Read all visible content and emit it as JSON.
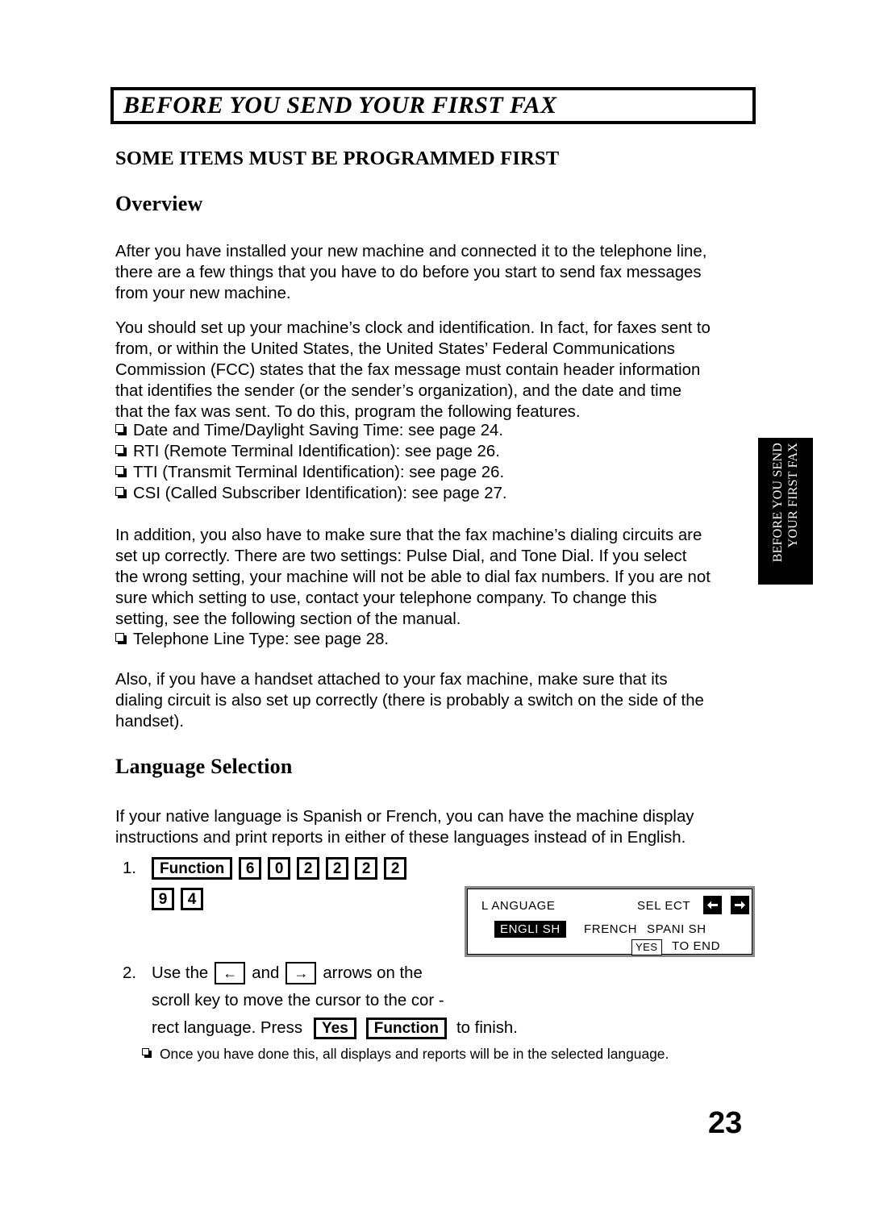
{
  "chapter": {
    "title": "BEFORE YOU SEND YOUR FIRST FAX"
  },
  "side_tab": {
    "line1": "BEFORE YOU SEND",
    "line2": "YOUR FIRST FAX"
  },
  "section": {
    "heading": "SOME ITEMS MUST BE PROGRAMMED FIRST"
  },
  "overview": {
    "heading": "Overview",
    "para1": [
      "After you have installed your new machine and connected it  to the telephone line,",
      "there are a few things that you have to do before you start to send fax messages",
      "from your new machine."
    ],
    "para2": [
      "You should set up your machine’s clock and identification. In fact, for faxes sent to",
      "from, or within the United States, the United States’ Federal Communications",
      "Commission (FCC) states that the fax message must contain header information",
      "that identifies the sender (or the sender’s organization), and the date and time",
      "that the fax was sent. To do this, program the following features."
    ],
    "feature_bullets": [
      "Date and Time/Daylight Saving Time: see page  24.",
      "RTI (Remote Terminal Identification): see page  26.",
      "TTI (Transmit Terminal Identification): see page  26.",
      "CSI (Called Subscriber Identification): see page  27."
    ],
    "para3": [
      "In addition, you also have to make sure that the fax machine’s dialing circuits are",
      "set up correctly. There are two settings: Pulse Dial, and Tone Dial. If you select",
      "the wrong setting, your machine will not be able to dial fax numbers. If you are not",
      "sure which setting to use, contact your telephone company. To change this",
      "setting, see the following section of the manual."
    ],
    "line_type_bullets": [
      "Telephone Line Type: see page  28."
    ],
    "para4": [
      "Also, if you have a handset attached to your fax machine, make sure that its",
      "dialing circuit is also set up correctly (there is probably a switch on the side of the",
      "handset)."
    ]
  },
  "language_selection": {
    "heading": "Language Selection",
    "para1": [
      "If your native language is Spanish or French, you can have the machine display",
      "instructions and print reports in either of these languages instead of in English."
    ],
    "step1": {
      "number": "1.",
      "keys_row1": [
        "Function",
        "6",
        "0",
        "2",
        "2",
        "2",
        "2"
      ],
      "keys_row2": [
        "9",
        "4"
      ]
    },
    "step2": {
      "number": "2.",
      "text_a": "Use the",
      "key_left": "←",
      "text_b": "and",
      "key_right": "→",
      "text_c": "arrows on the",
      "line2": "scroll key to move the cursor to the cor -",
      "text_d": "rect language. Press",
      "key_yes": "Yes",
      "key_function": "Function",
      "text_e": "to finish."
    },
    "note": "Once you have done this, all displays and reports will be in the selected language."
  },
  "lcd": {
    "title": "L ANGUAGE",
    "select_label": "SEL ECT",
    "options": {
      "selected": "ENGLI SH",
      "second": "FRENCH",
      "third": "SPANI SH"
    },
    "yes_key": "YES",
    "to_end": "TO END",
    "arrow_left": "left-arrow-icon",
    "arrow_right": "right-arrow-icon"
  },
  "page": {
    "number": "23"
  },
  "colors": {
    "ink": "#000000",
    "paper": "#ffffff",
    "lcd_border": "#8a8a8a"
  }
}
